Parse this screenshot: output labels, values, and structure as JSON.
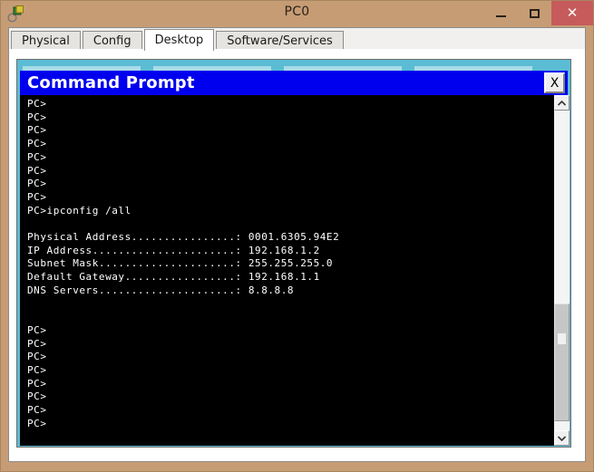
{
  "window": {
    "title": "PC0",
    "icon": "packet-tracer-icon",
    "controls": {
      "minimize_label": "–",
      "maximize_label": "□",
      "close_label": "✕"
    },
    "colors": {
      "frame": "#c69c75",
      "close_button": "#c75b5b",
      "terminal_title": "#0000ee",
      "accent_cyan": "#5bbcd4"
    }
  },
  "tabs": [
    {
      "label": "Physical",
      "active": false
    },
    {
      "label": "Config",
      "active": false
    },
    {
      "label": "Desktop",
      "active": true
    },
    {
      "label": "Software/Services",
      "active": false
    }
  ],
  "command_prompt": {
    "title": "Command Prompt",
    "close_label": "X",
    "lines": [
      "PC>",
      "PC>",
      "PC>",
      "PC>",
      "PC>",
      "PC>",
      "PC>",
      "PC>",
      "PC>ipconfig /all",
      "",
      "Physical Address................: 0001.6305.94E2",
      "IP Address......................: 192.168.1.2",
      "Subnet Mask.....................: 255.255.255.0",
      "Default Gateway.................: 192.168.1.1",
      "DNS Servers.....................: 8.8.8.8",
      "",
      "",
      "PC>",
      "PC>",
      "PC>",
      "PC>",
      "PC>",
      "PC>",
      "PC>",
      "PC>"
    ],
    "command": "ipconfig /all",
    "prompt": "PC>",
    "ipconfig_output": {
      "physical_address": "0001.6305.94E2",
      "ip_address": "192.168.1.2",
      "subnet_mask": "255.255.255.0",
      "default_gateway": "192.168.1.1",
      "dns_servers": "8.8.8.8"
    },
    "scrollbar": {
      "up_arrow": "chevron-up-icon",
      "down_arrow": "chevron-down-icon"
    }
  }
}
